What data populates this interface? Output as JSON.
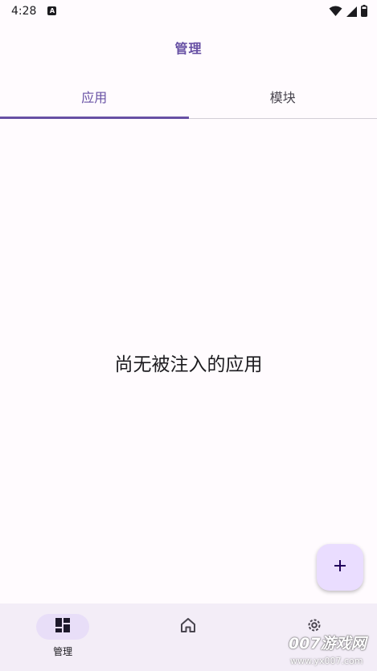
{
  "status_bar": {
    "time": "4:28",
    "notification_badge": "A",
    "icons": [
      "wifi-icon",
      "signal-icon",
      "battery-icon"
    ]
  },
  "app_bar": {
    "title": "管理"
  },
  "tabs": [
    {
      "label": "应用",
      "active": true
    },
    {
      "label": "模块",
      "active": false
    }
  ],
  "main": {
    "empty_message": "尚无被注入的应用"
  },
  "fab": {
    "icon": "add-icon"
  },
  "bottom_nav": {
    "items": [
      {
        "label": "管理",
        "icon": "dashboard-icon",
        "active": true
      },
      {
        "label": "",
        "icon": "home-icon",
        "active": false
      },
      {
        "label": "",
        "icon": "settings-icon",
        "active": false
      }
    ]
  },
  "watermark": {
    "text": "007游戏网",
    "url": "www.yx007.com"
  },
  "colors": {
    "accent": "#6750a4",
    "background": "#fffbfe",
    "nav_background": "#f3edf7",
    "fab_background": "#eaddff",
    "active_pill": "#e8def8"
  }
}
